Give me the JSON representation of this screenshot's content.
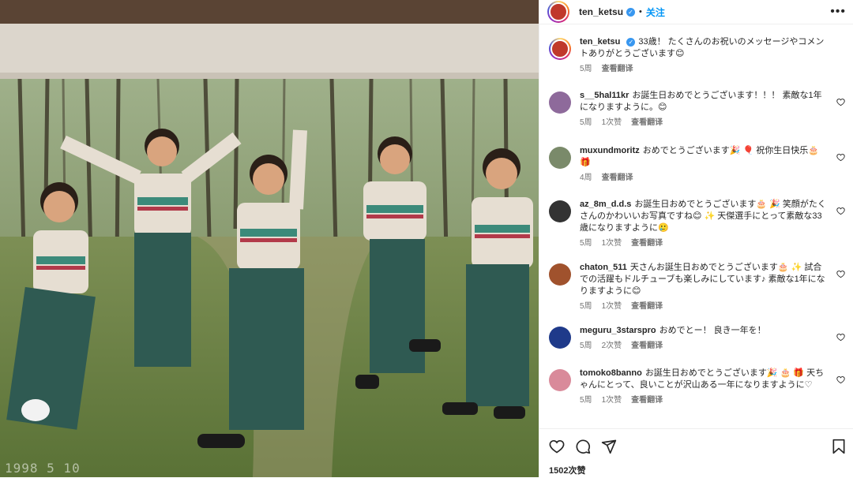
{
  "photo": {
    "date_stamp": "1998 5 10"
  },
  "post": {
    "username": "ten_ketsu",
    "follow_label": "关注",
    "more_label": "•••"
  },
  "comments": [
    {
      "user": "ten_ketsu",
      "verified": true,
      "text": "33歳！ たくさんのお祝いのメッセージやコメントありがとうございます😊",
      "time": "5周",
      "likes": "",
      "translate": "查看翻译",
      "color": "#c0392b",
      "like_icon": false
    },
    {
      "user": "s__5hal11kr",
      "text": "お誕生日おめでとうございます！！！ 素敵な1年になりますように。😊",
      "time": "5周",
      "likes": "1次赞",
      "translate": "查看翻译",
      "color": "#8e6a9b",
      "like_icon": true
    },
    {
      "user": "muxundmoritz",
      "text": "おめでとうございます🎉 🎈 祝你生日快乐🎂 🎁",
      "time": "4周",
      "likes": "",
      "translate": "查看翻译",
      "color": "#7a8a6a",
      "like_icon": true
    },
    {
      "user": "az_8m_d.d.s",
      "text": "お誕生日おめでとうございます🎂 🎉 笑顔がたくさんのかわいいお写真ですね😊 ✨ 天傑選手にとって素敵な33歳になりますように🥲",
      "time": "5周",
      "likes": "1次赞",
      "translate": "查看翻译",
      "color": "#333333",
      "like_icon": true
    },
    {
      "user": "chaton_511",
      "text": "天さんお誕生日おめでとうございます🎂 ✨ 試合での活躍もドルチューブも楽しみにしています♪ 素敵な1年になりますように😊",
      "time": "5周",
      "likes": "1次赞",
      "translate": "查看翻译",
      "color": "#a0522d",
      "like_icon": true
    },
    {
      "user": "meguru_3starspro",
      "text": "おめでとー！ 良き一年を！",
      "time": "5周",
      "likes": "2次赞",
      "translate": "查看翻译",
      "color": "#1f3a8a",
      "like_icon": true
    },
    {
      "user": "tomoko8banno",
      "text": "お誕生日おめでとうございます🎉 🎂 🎁 天ちゃんにとって、良いことが沢山ある一年になりますように♡",
      "time": "5周",
      "likes": "1次赞",
      "translate": "查看翻译",
      "color": "#d98a9a",
      "like_icon": true
    }
  ],
  "actions": {
    "heart_icon": "heart-icon",
    "comment_icon": "comment-icon",
    "share_icon": "share-icon",
    "save_icon": "bookmark-icon",
    "likes": "1502次赞"
  }
}
